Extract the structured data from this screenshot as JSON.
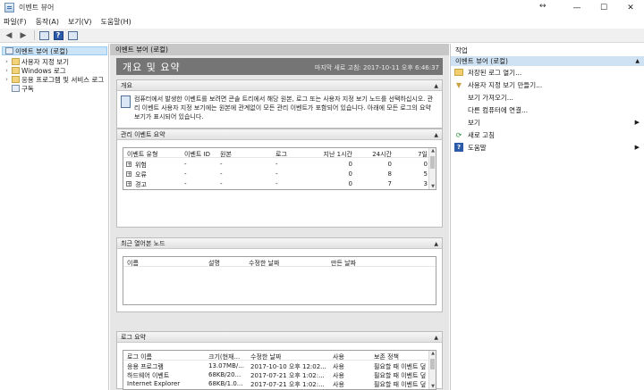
{
  "window": {
    "title": "이벤트 뷰어",
    "resize_glyph": "↔",
    "controls": [
      "—",
      "☐",
      "✕"
    ]
  },
  "menu": [
    "파일(F)",
    "동작(A)",
    "보기(V)",
    "도움말(H)"
  ],
  "toolbar": {
    "back_glyph": "◀",
    "forward_glyph": "▶",
    "help_glyph": "?"
  },
  "tree": {
    "root": "이벤트 뷰어 (로컬)",
    "children": [
      "사용자 지정 보기",
      "Windows 로그",
      "응용 프로그램 및 서비스 로그",
      "구독"
    ]
  },
  "center": {
    "header": "이벤트 뷰어 (로컬)",
    "title": "개요 및 요약",
    "last_refresh": "마지막 새로 고침: 2017-10-11 오후 6:46:37",
    "overview": {
      "heading": "개요",
      "text": "컴퓨터에서 발생한 이벤트를 보려면 콘솔 트리에서 해당 원본, 로그 또는 사용자 지정 보기 노드를 선택하십시오. 관리 이벤트 사용자 지정 보기에는 원본에 관계없이 모든 관리 이벤트가 포함되어 있습니다. 아래에 모든 로그의 요약 보기가 표시되어 있습니다."
    },
    "admin_summary": {
      "heading": "관리 이벤트 요약",
      "columns": [
        "이벤트 유형",
        "이벤트 ID",
        "원본",
        "로그",
        "지난 1시간",
        "24시간",
        "7일"
      ],
      "rows": [
        [
          "위험",
          "-",
          "-",
          "-",
          "0",
          "0",
          "0"
        ],
        [
          "오류",
          "-",
          "-",
          "-",
          "0",
          "8",
          "5"
        ],
        [
          "경고",
          "-",
          "-",
          "-",
          "0",
          "7",
          "3"
        ]
      ]
    },
    "recent_nodes": {
      "heading": "최근 열어본 노드",
      "columns": [
        "이름",
        "설명",
        "수정한 날짜",
        "만든 날짜"
      ]
    },
    "log_summary": {
      "heading": "로그 요약",
      "columns": [
        "로그 이름",
        "크기(현재...",
        "수정한 날짜",
        "사용",
        "보존 정책"
      ],
      "rows": [
        [
          "응용 프로그램",
          "13.07MB/...",
          "2017-10-10 오후 12:02...",
          "사용",
          "필요할 때 이벤트 덮"
        ],
        [
          "하드웨어 이벤트",
          "68KB/20...",
          "2017-07-21 오후 1:02:...",
          "사용",
          "필요할 때 이벤트 덮"
        ],
        [
          "Internet Explorer",
          "68KB/1.0...",
          "2017-07-21 오후 1:02:...",
          "사용",
          "필요할 때 이벤트 덮"
        ]
      ]
    }
  },
  "actions": {
    "header": "작업",
    "subheader": "이벤트 뷰어 (로컬)",
    "items": [
      "저장된 로그 열기...",
      "사용자 지정 보기 만들기...",
      "보기 가져오기...",
      "다른 컴퓨터에 연결...",
      "보기",
      "새로 고침",
      "도움말"
    ]
  },
  "colors": {
    "selection": "#cce4f7",
    "overview_bar": "#757575",
    "center_bg": "#e6e6e6"
  }
}
